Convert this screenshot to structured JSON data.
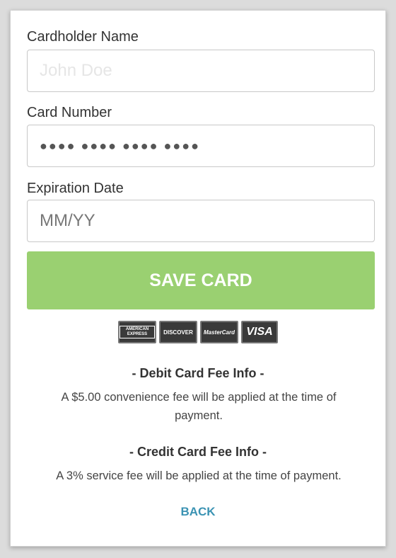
{
  "form": {
    "cardholder_label": "Cardholder Name",
    "cardholder_placeholder": "John Doe",
    "card_number_label": "Card Number",
    "card_number_masked": "●●●● ●●●● ●●●● ●●●●",
    "expiration_label": "Expiration Date",
    "expiration_placeholder": "MM/YY",
    "save_label": "SAVE CARD"
  },
  "card_logos": {
    "amex": "AMERICAN EXPRESS",
    "discover": "DISCOVER",
    "mastercard": "MasterCard",
    "visa": "VISA"
  },
  "fees": {
    "debit_title": "- Debit Card Fee Info -",
    "debit_text": "A $5.00 convenience fee will be applied at the time of payment.",
    "credit_title": "- Credit Card Fee Info -",
    "credit_text": "A 3% service fee will be applied at the time of payment."
  },
  "back_label": "BACK",
  "colors": {
    "save_button": "#9ad071",
    "back_link": "#3b93b3"
  }
}
